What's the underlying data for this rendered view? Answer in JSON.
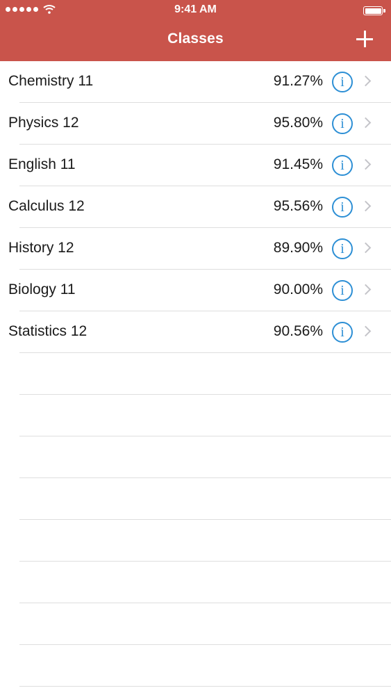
{
  "status_bar": {
    "time": "9:41 AM",
    "signal_icon": "signal-dots-icon",
    "wifi_icon": "wifi-icon",
    "battery_icon": "battery-icon"
  },
  "nav": {
    "title": "Classes",
    "add_icon": "plus-icon",
    "background_color": "#c9544b"
  },
  "classes": [
    {
      "name": "Chemistry 11",
      "grade": "91.27%"
    },
    {
      "name": "Physics 12",
      "grade": "95.80%"
    },
    {
      "name": "English 11",
      "grade": "91.45%"
    },
    {
      "name": "Calculus 12",
      "grade": "95.56%"
    },
    {
      "name": "History 12",
      "grade": "89.90%"
    },
    {
      "name": "Biology 11",
      "grade": "90.00%"
    },
    {
      "name": "Statistics 12",
      "grade": "90.56%"
    }
  ],
  "row_icons": {
    "info": "info-icon",
    "disclosure": "chevron-right-icon",
    "info_color": "#2d8fd5"
  }
}
